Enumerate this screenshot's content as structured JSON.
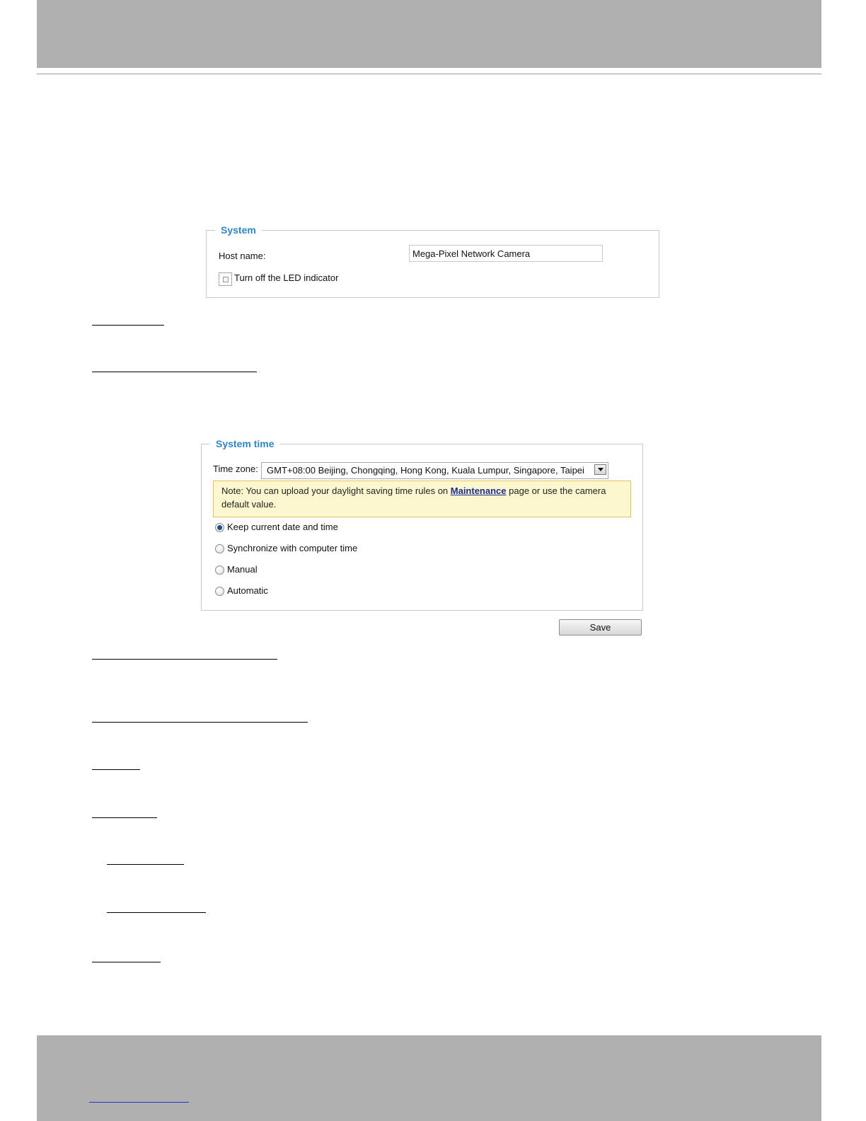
{
  "system_panel": {
    "legend": "System",
    "host_name_label": "Host name:",
    "host_name_value": "Mega-Pixel Network Camera",
    "led_checkbox_label": "Turn off the LED indicator",
    "led_checkbox_checked": false
  },
  "system_time_panel": {
    "legend": "System time",
    "time_zone_label": "Time zone:",
    "time_zone_value": "GMT+08:00 Beijing, Chongqing, Hong Kong, Kuala Lumpur, Singapore, Taipei",
    "note_prefix": "Note: You can upload your daylight saving time rules on ",
    "note_link": "Maintenance",
    "note_suffix": " page or use the camera default value.",
    "radio_options": [
      {
        "label": "Keep current date and time",
        "selected": true
      },
      {
        "label": "Synchronize with computer time",
        "selected": false
      },
      {
        "label": "Manual",
        "selected": false
      },
      {
        "label": "Automatic",
        "selected": false
      }
    ],
    "save_label": "Save"
  },
  "colors": {
    "legend_blue": "#2f86c4",
    "note_background": "#fdf7d0",
    "note_border": "#e6c25c",
    "band_gray": "#b0b0b0"
  }
}
